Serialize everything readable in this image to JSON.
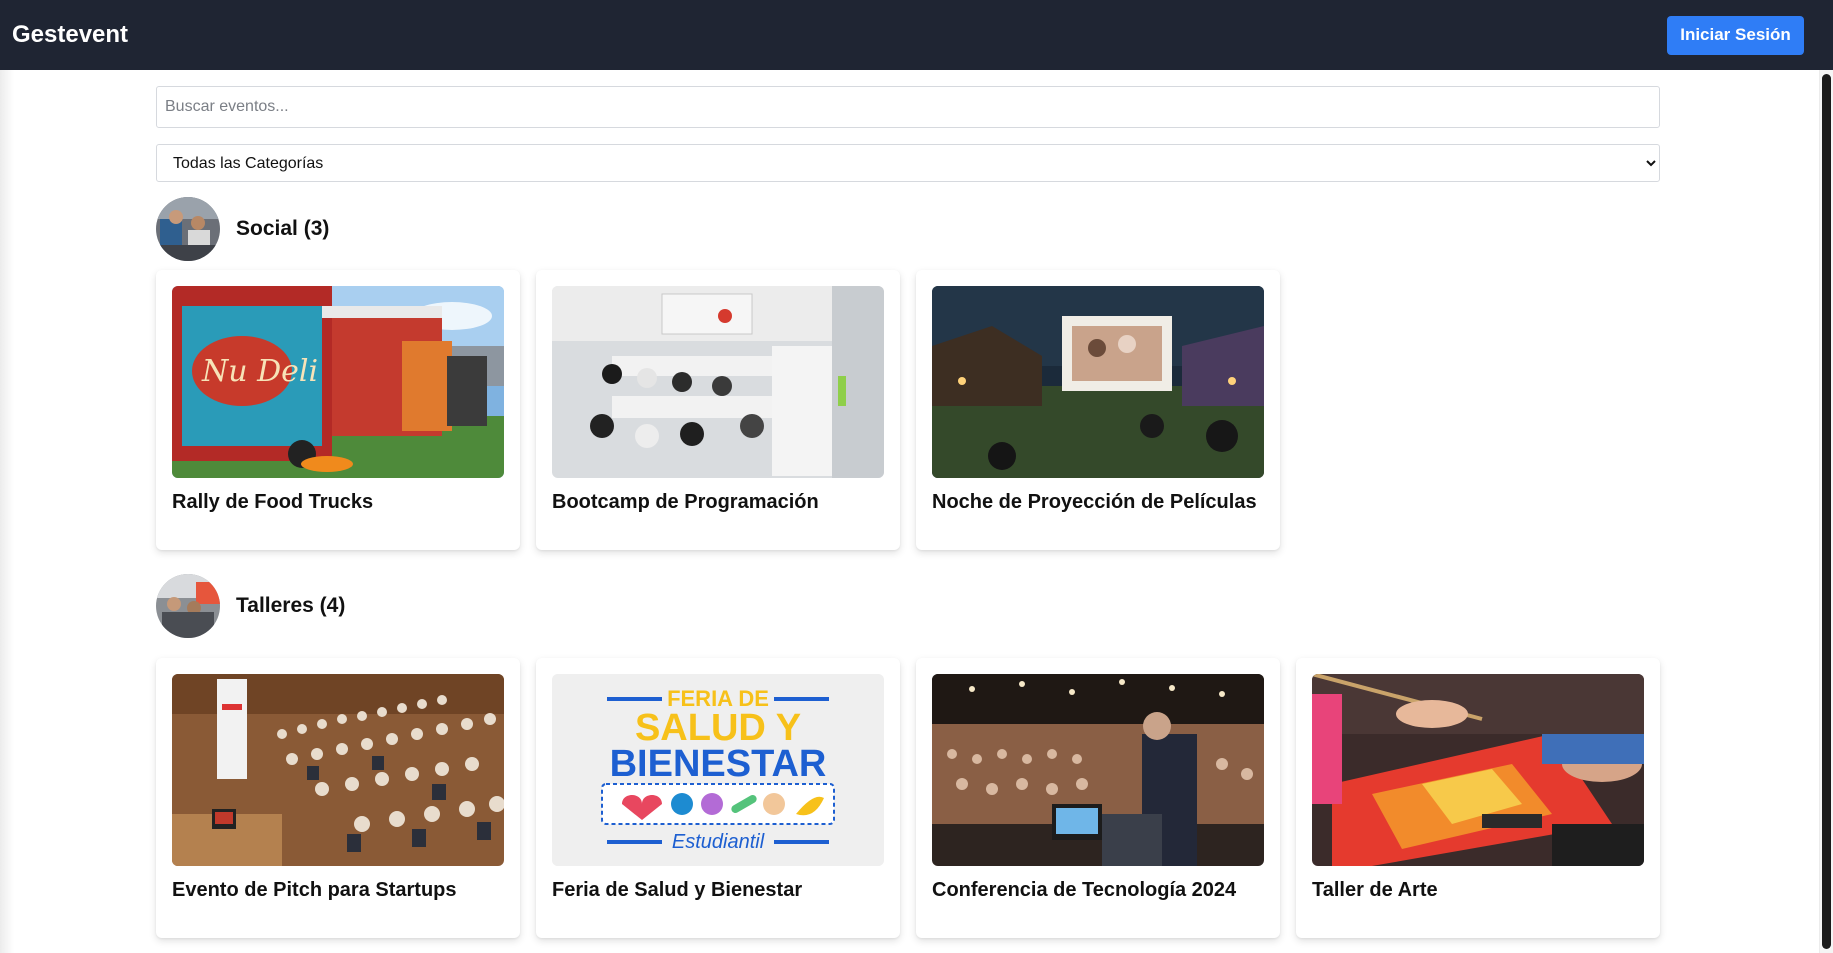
{
  "app": {
    "brand": "Gestevent",
    "login_label": "Iniciar Sesión"
  },
  "search": {
    "placeholder": "Buscar eventos...",
    "value": ""
  },
  "category_filter": {
    "selected": "Todas las Categorías"
  },
  "categories": [
    {
      "title": "Social (3)",
      "events": [
        {
          "title": "Rally de Food Trucks",
          "image": "food-truck-photo"
        },
        {
          "title": "Bootcamp de Programación",
          "image": "classroom-laptops-photo"
        },
        {
          "title": "Noche de Proyección de Películas",
          "image": "outdoor-movie-screen-photo"
        }
      ]
    },
    {
      "title": "Talleres (4)",
      "events": [
        {
          "title": "Evento de Pitch para Startups",
          "image": "audience-pitch-photo"
        },
        {
          "title": "Feria de Salud y Bienestar",
          "image": "health-fair-poster",
          "poster_lines": [
            "FERIA DE",
            "SALUD Y",
            "BIENESTAR",
            "Estudiantil"
          ]
        },
        {
          "title": "Conferencia de Tecnología 2024",
          "image": "conference-speaker-photo"
        },
        {
          "title": "Taller de Arte",
          "image": "painting-hands-photo"
        }
      ]
    }
  ],
  "colors": {
    "navbar": "#1f2533",
    "button": "#2f7df6",
    "poster_yellow": "#f7c11a",
    "poster_blue": "#1d5fd1"
  }
}
